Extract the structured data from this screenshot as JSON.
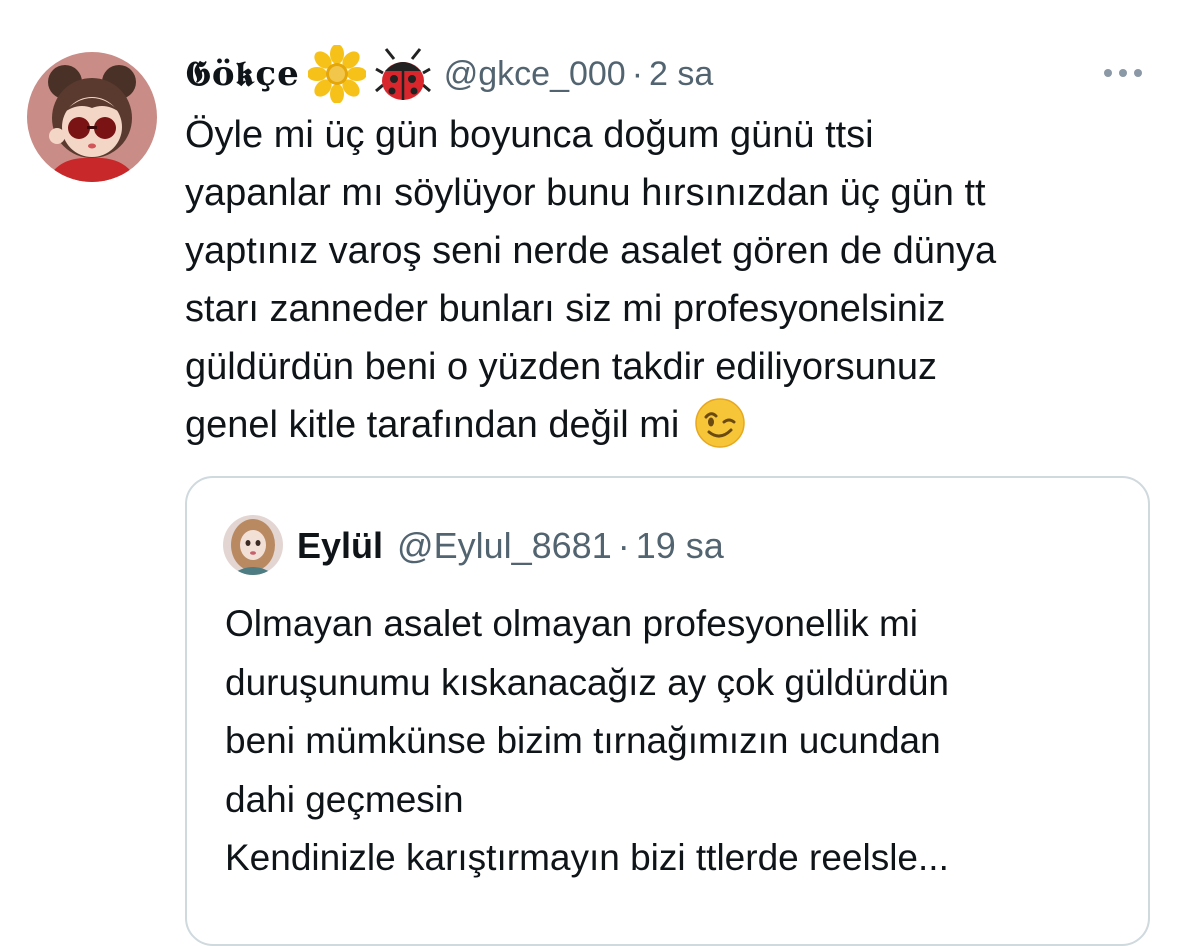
{
  "tweet": {
    "display_name": "𝕲ö𝖐çe",
    "name_emojis": [
      "sunflower-icon",
      "ladybug-icon"
    ],
    "handle": "@gkce_000",
    "separator": "·",
    "time": "2 sa",
    "more_icon": "more-icon",
    "text_lines": [
      "Öyle mi üç gün boyunca doğum günü ttsi",
      "yapanlar mı söylüyor bunu hırsınızdan üç gün tt",
      "yaptınız varoş seni nerde asalet gören de dünya",
      "starı zanneder bunları siz mi profesyonelsiniz",
      "güldürdün beni o yüzden takdir ediliyorsunuz",
      "genel kitle tarafından değil mi"
    ],
    "trailing_emoji": "winking-face-icon"
  },
  "quote": {
    "display_name": "Eylül",
    "handle": "@Eylul_8681",
    "separator": "·",
    "time": "19 sa",
    "text_lines": [
      "Olmayan asalet olmayan profesyonellik mi",
      "duruşunumu kıskanacağız ay çok güldürdün",
      "beni mümkünse bizim tırnağımızın ucundan",
      "dahi geçmesin",
      "Kendinizle karıştırmayın bizi ttlerde reelsle..."
    ]
  },
  "colors": {
    "text_primary": "#0f1419",
    "text_secondary": "#536471",
    "border": "#cfd9de"
  }
}
